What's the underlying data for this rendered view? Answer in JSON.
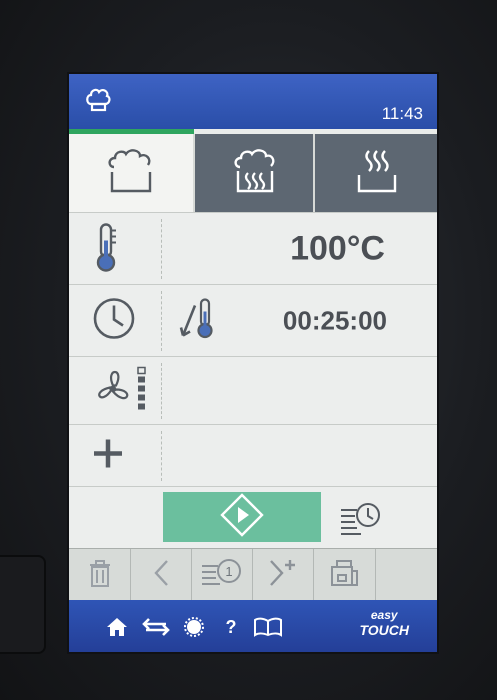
{
  "header": {
    "clock": "11:43",
    "chef_icon": "chef-hat-icon"
  },
  "tabs": [
    {
      "name": "hot-air",
      "icon": "hot-air-icon",
      "active": true
    },
    {
      "name": "combi-steam",
      "icon": "combi-steam-icon",
      "active": false
    },
    {
      "name": "steam",
      "icon": "steam-icon",
      "active": false
    }
  ],
  "rows": {
    "temperature": {
      "icon": "thermometer-icon",
      "value": "100°C"
    },
    "time": {
      "icon": "clock-icon",
      "sub_icon": "core-temp-probe-icon",
      "value": "00:25:00"
    },
    "fan": {
      "icon": "fan-icon",
      "level_bars": 5
    },
    "add": {
      "icon": "plus-icon"
    }
  },
  "actions": {
    "start_icon": "start-icon",
    "schedule_icon": "schedule-icon"
  },
  "toolbar": [
    {
      "name": "delete",
      "icon": "trash-icon"
    },
    {
      "name": "back",
      "icon": "chevron-left-icon"
    },
    {
      "name": "step",
      "icon": "step-timer-icon",
      "badge": "1"
    },
    {
      "name": "add-step",
      "icon": "chevron-right-plus-icon"
    },
    {
      "name": "save",
      "icon": "save-icon"
    }
  ],
  "bottombar": {
    "icons": [
      "home-icon",
      "return-icon",
      "settings-icon",
      "help-icon",
      "book-icon"
    ],
    "help_label": "?",
    "brand_line1": "easy",
    "brand_line2": "TOUCH"
  },
  "colors": {
    "header_blue": "#2a4ea8",
    "tab_dark": "#5d6772",
    "start_green": "#6bbf9e",
    "active_indicator": "#2fa55f"
  }
}
